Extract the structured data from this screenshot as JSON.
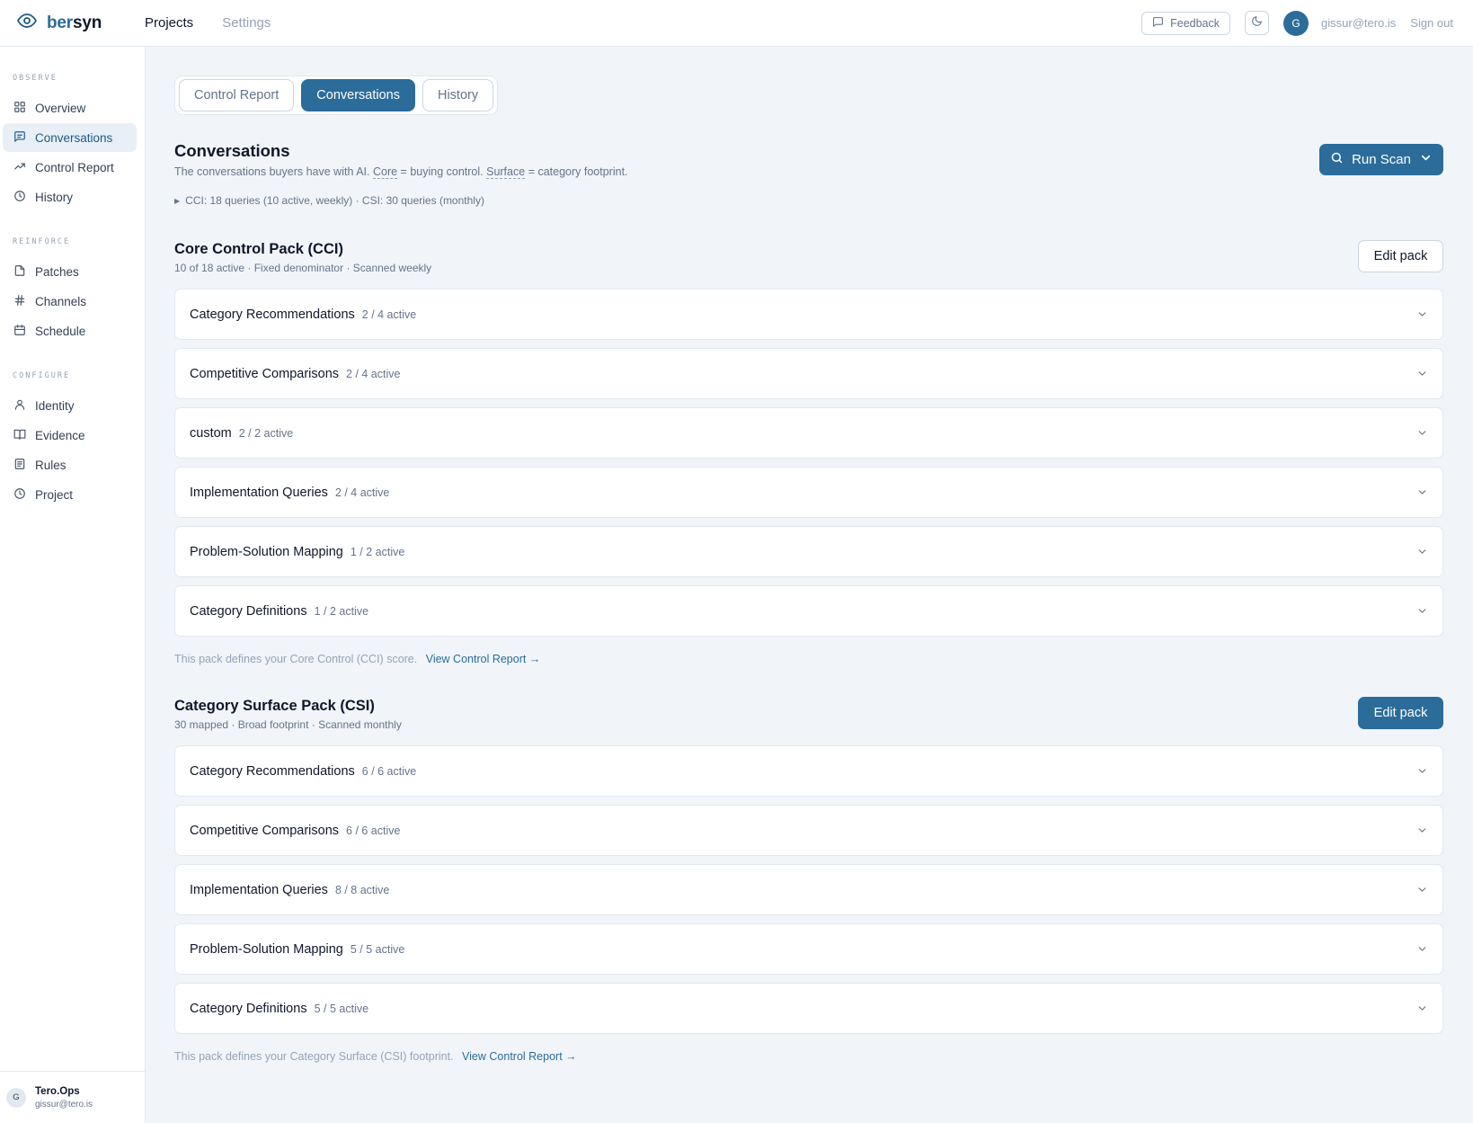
{
  "brand": {
    "ber": "ber",
    "syn": "syn"
  },
  "topnav": {
    "projects": "Projects",
    "settings": "Settings"
  },
  "topbar": {
    "feedback": "Feedback",
    "avatar_initial": "G",
    "email": "gissur@tero.is",
    "signout": "Sign out"
  },
  "sidebar": {
    "sections": [
      {
        "label": "OBSERVE",
        "items": [
          {
            "label": "Overview",
            "icon": "grid-icon"
          },
          {
            "label": "Conversations",
            "icon": "message-icon",
            "active": true
          },
          {
            "label": "Control Report",
            "icon": "trending-icon"
          },
          {
            "label": "History",
            "icon": "clock-icon"
          }
        ]
      },
      {
        "label": "REINFORCE",
        "items": [
          {
            "label": "Patches",
            "icon": "file-icon"
          },
          {
            "label": "Channels",
            "icon": "hash-icon"
          },
          {
            "label": "Schedule",
            "icon": "calendar-icon"
          }
        ]
      },
      {
        "label": "CONFIGURE",
        "items": [
          {
            "label": "Identity",
            "icon": "user-icon"
          },
          {
            "label": "Evidence",
            "icon": "book-icon"
          },
          {
            "label": "Rules",
            "icon": "list-icon"
          },
          {
            "label": "Project",
            "icon": "clock-icon"
          }
        ]
      }
    ],
    "footer": {
      "initial": "G",
      "name": "Tero.Ops",
      "email": "gissur@tero.is"
    }
  },
  "tabs": [
    "Control Report",
    "Conversations",
    "History"
  ],
  "page": {
    "title": "Conversations",
    "subtitle_prefix": "The conversations buyers have with AI.",
    "core": "Core",
    "core_desc": "= buying control.",
    "surface": "Surface",
    "surface_desc": "= category footprint.",
    "summary": "CCI: 18 queries (10 active, weekly) · CSI: 30 queries (monthly)",
    "run_scan": "Run Scan"
  },
  "cci": {
    "title": "Core Control Pack (CCI)",
    "meta": "10 of 18 active · Fixed denominator · Scanned weekly",
    "edit": "Edit pack",
    "rows": [
      {
        "name": "Category Recommendations",
        "count": "2 / 4 active"
      },
      {
        "name": "Competitive Comparisons",
        "count": "2 / 4 active"
      },
      {
        "name": "custom",
        "count": "2 / 2 active"
      },
      {
        "name": "Implementation Queries",
        "count": "2 / 4 active"
      },
      {
        "name": "Problem-Solution Mapping",
        "count": "1 / 2 active"
      },
      {
        "name": "Category Definitions",
        "count": "1 / 2 active"
      }
    ],
    "footer": "This pack defines your Core Control (CCI) score.",
    "link": "View Control Report →"
  },
  "csi": {
    "title": "Category Surface Pack (CSI)",
    "meta": "30 mapped · Broad footprint · Scanned monthly",
    "edit": "Edit pack",
    "rows": [
      {
        "name": "Category Recommendations",
        "count": "6 / 6 active"
      },
      {
        "name": "Competitive Comparisons",
        "count": "6 / 6 active"
      },
      {
        "name": "Implementation Queries",
        "count": "8 / 8 active"
      },
      {
        "name": "Problem-Solution Mapping",
        "count": "5 / 5 active"
      },
      {
        "name": "Category Definitions",
        "count": "5 / 5 active"
      }
    ],
    "footer": "This pack defines your Category Surface (CSI) footprint.",
    "link": "View Control Report →"
  },
  "colors": {
    "accent": "#2b6c9a",
    "background": "#f1f5f9",
    "border": "#e2e8f0",
    "muted": "#64748b"
  }
}
